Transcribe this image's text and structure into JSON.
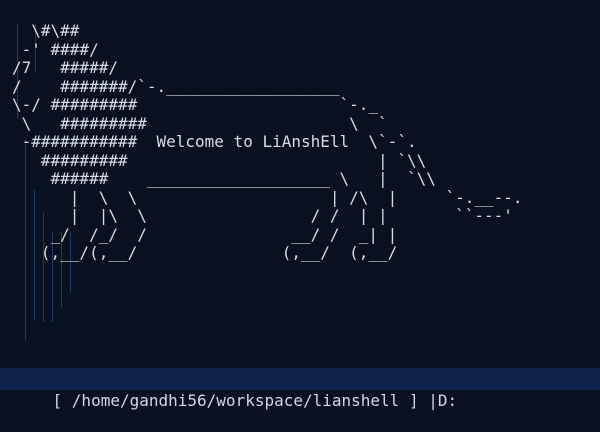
{
  "terminal": {
    "banner_art": "  \\#\\##\n -' ####/\n/7   #####/\n/    #######/`-.__________________\n\\-/ #########                     `-._\n \\   #########                     \\  `\n -###########  Welcome to LiAnshEll  \\`-`.\n   #########                          | `\\\\\n    ######    ___________________ \\   |  `\\\\\n      |  \\  \\                    | /\\  |     `-.__--.\n      |  |\\  \\                 / /  | |       ``---'\n    _/  /_/  /               __/ /  _| |\n   (,__/(,__/               (,__/  (,__/",
    "prompt": "[ /home/gandhi56/workspace/lianshell ] |D:",
    "colors": {
      "background": "#07111f",
      "text": "#d7dbe2",
      "prompt_bar": "#0f2448",
      "guide_lines": "#1e3a68"
    }
  }
}
